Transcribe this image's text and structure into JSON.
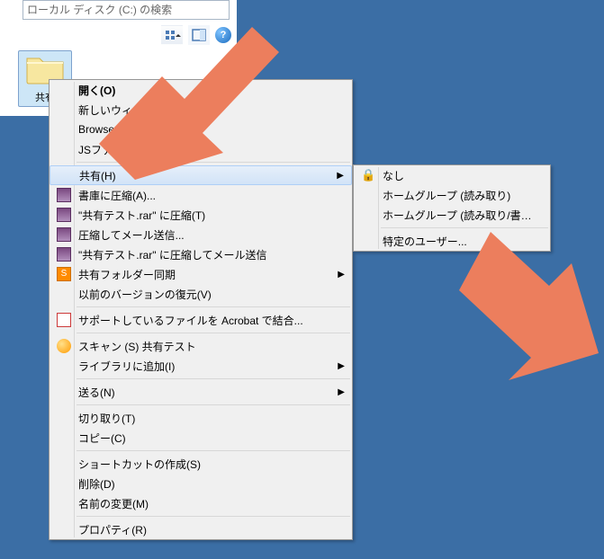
{
  "explorer": {
    "search_placeholder": "ローカル ディスク (C:) の検索",
    "folder_label": "共有"
  },
  "menu": {
    "open": "開く(O)",
    "new_window": "新しいウィンド",
    "browse": "Browse in                       ge CS5.1",
    "jsfile": "JSファイル検索             行(J)...",
    "share": "共有(H)",
    "archive": "書庫に圧縮(A)...",
    "compress1": "\"共有テスト.rar\" に圧縮(T)",
    "compress_mail": "圧縮してメール送信...",
    "compress_mail2": "\"共有テスト.rar\" に圧縮してメール送信",
    "sync": "共有フォルダー同期",
    "prev_ver": "以前のバージョンの復元(V)",
    "acrobat": "サポートしているファイルを Acrobat で結合...",
    "scan": "スキャン (S) 共有テスト",
    "library": "ライブラリに追加(I)",
    "send": "送る(N)",
    "cut": "切り取り(T)",
    "copy": "コピー(C)",
    "shortcut": "ショートカットの作成(S)",
    "delete": "削除(D)",
    "rename": "名前の変更(M)",
    "props": "プロパティ(R)"
  },
  "submenu": {
    "none": "なし",
    "hg_read": "ホームグループ (読み取り)",
    "hg_rw": "ホームグループ (読み取り/書き込み)",
    "specific": "特定のユーザー..."
  }
}
